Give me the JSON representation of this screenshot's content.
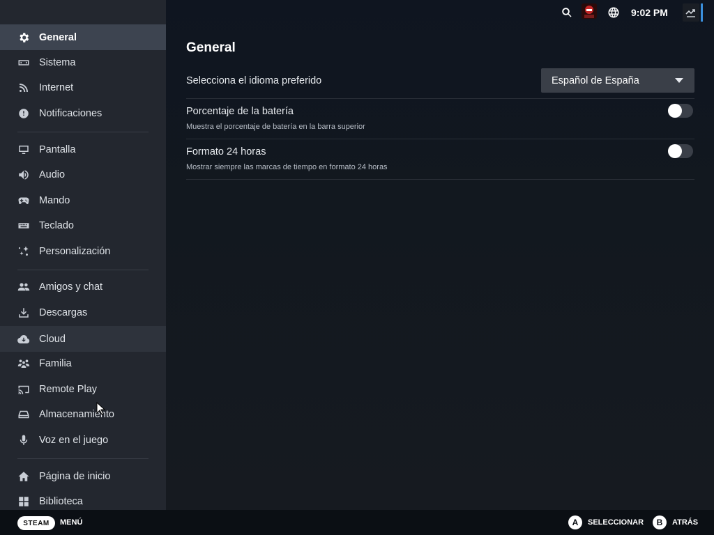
{
  "sidebar": {
    "items": [
      {
        "label": "General",
        "icon": "gear-icon",
        "active": true
      },
      {
        "label": "Sistema",
        "icon": "system-icon"
      },
      {
        "label": "Internet",
        "icon": "wifi-icon"
      },
      {
        "label": "Notificaciones",
        "icon": "alert-icon"
      },
      {
        "label": "Pantalla",
        "icon": "monitor-icon"
      },
      {
        "label": "Audio",
        "icon": "speaker-icon"
      },
      {
        "label": "Mando",
        "icon": "gamepad-icon"
      },
      {
        "label": "Teclado",
        "icon": "keyboard-icon"
      },
      {
        "label": "Personalización",
        "icon": "sparkle-icon"
      },
      {
        "label": "Amigos y chat",
        "icon": "friends-icon"
      },
      {
        "label": "Descargas",
        "icon": "download-icon"
      },
      {
        "label": "Cloud",
        "icon": "cloud-icon",
        "hover": true
      },
      {
        "label": "Familia",
        "icon": "family-icon"
      },
      {
        "label": "Remote Play",
        "icon": "cast-icon"
      },
      {
        "label": "Almacenamiento",
        "icon": "storage-icon"
      },
      {
        "label": "Voz en el juego",
        "icon": "microphone-icon"
      },
      {
        "label": "Página de inicio",
        "icon": "home-icon"
      },
      {
        "label": "Biblioteca",
        "icon": "grid-icon"
      }
    ]
  },
  "topbar": {
    "time": "9:02 PM",
    "icons": [
      "search-icon",
      "avatar",
      "globe-icon",
      "downloads-icon"
    ]
  },
  "main": {
    "title": "General",
    "language": {
      "label": "Selecciona el idioma preferido",
      "value": "Español de España"
    },
    "battery": {
      "label": "Porcentaje de la batería",
      "description": "Muestra el porcentaje de batería en la barra superior",
      "enabled": false
    },
    "clock24": {
      "label": "Formato 24 horas",
      "description": "Mostrar siempre las marcas de tiempo en formato 24 horas",
      "enabled": false
    }
  },
  "footer": {
    "steam": "STEAM",
    "menu": "MENÚ",
    "a_key": "A",
    "select": "SELECCIONAR",
    "b_key": "B",
    "back": "ATRÁS"
  },
  "colors": {
    "sidebar_bg": "#23272f",
    "active_bg": "#3d4450",
    "main_bg": "#0e141b",
    "accent": "#3a8fdc"
  }
}
